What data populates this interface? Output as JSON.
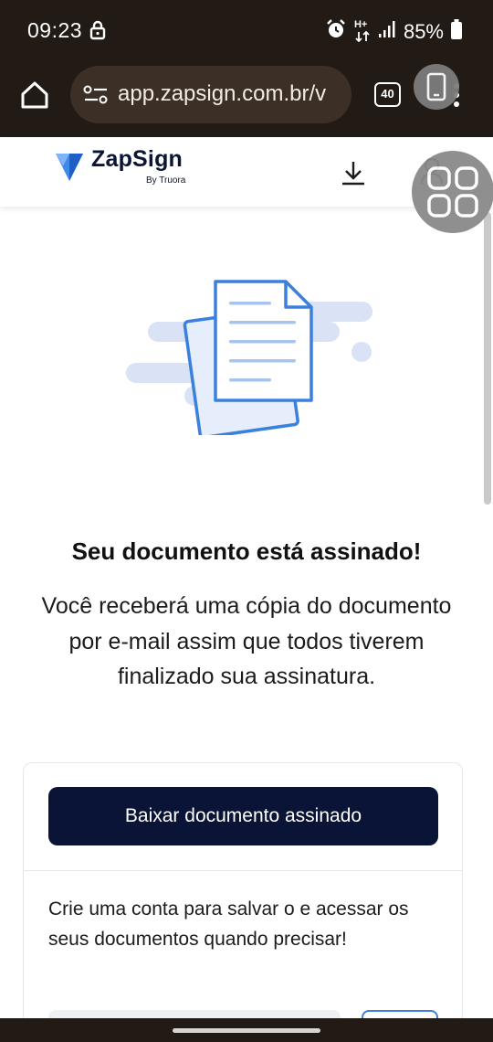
{
  "status_bar": {
    "time": "09:23",
    "battery_percent": "85%",
    "network_label": "H+",
    "icons": [
      "lock-icon",
      "alarm-icon",
      "data-arrows-icon",
      "signal-icon",
      "battery-icon"
    ]
  },
  "browser": {
    "url": "app.zapsign.com.br/v",
    "tab_count": "40",
    "icons": [
      "home-icon",
      "site-settings-icon",
      "tabs-icon",
      "menu-icon",
      "phone-icon"
    ]
  },
  "header": {
    "brand_name": "ZapSign",
    "brand_byline": "By Truora",
    "icons": [
      "zapsign-logo-icon",
      "download-icon",
      "user-icon",
      "grid-icon"
    ]
  },
  "main": {
    "heading": "Seu documento está assinado!",
    "message": "Você receberá uma cópia do documento por e-mail assim que todos tiverem finalizado sua assinatura.",
    "download_button": "Baixar documento assinado",
    "account_prompt": "Crie uma conta para salvar o e acessar os seus documentos quando precisar!"
  },
  "colors": {
    "system_bar": "#221a14",
    "primary_button": "#0a1437",
    "accent_blue": "#3f7fe0",
    "illustration_light": "#d9e3f5"
  }
}
